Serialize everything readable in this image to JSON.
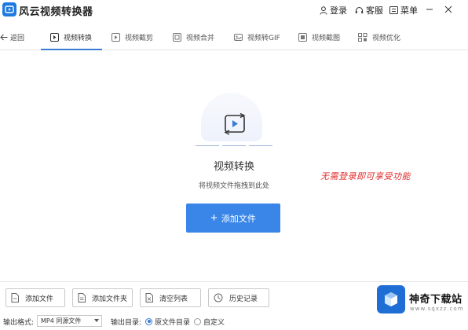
{
  "app": {
    "title": "风云视频转换器"
  },
  "titlebar": {
    "login": "登录",
    "service": "客服",
    "menu": "菜单"
  },
  "nav": {
    "back": "返回",
    "tabs": [
      {
        "label": "视频转换",
        "icon": "video-convert-icon",
        "active": true
      },
      {
        "label": "视频截剪",
        "icon": "video-cut-icon",
        "active": false
      },
      {
        "label": "视频合并",
        "icon": "video-merge-icon",
        "active": false
      },
      {
        "label": "视频转GIF",
        "icon": "gif-icon",
        "active": false
      },
      {
        "label": "视频截图",
        "icon": "screenshot-icon",
        "active": false
      },
      {
        "label": "视频优化",
        "icon": "optimize-icon",
        "active": false
      }
    ]
  },
  "main": {
    "heading": "视频转换",
    "subtitle": "将视频文件拖拽到此处",
    "add_file_label": "添加文件",
    "promo": "无需登录即可享受功能"
  },
  "bottom": {
    "add_file": "添加文件",
    "add_folder": "添加文件夹",
    "clear_list": "清空列表",
    "history": "历史记录",
    "output_format_label": "输出格式:",
    "output_format_value": "MP4 同源文件",
    "output_dir_label": "输出目录:",
    "option_source": "原文件目录",
    "option_custom": "自定义"
  },
  "watermark": {
    "name": "神奇下载站",
    "url": "www.sqxzz.com"
  },
  "colors": {
    "accent": "#3a86e8",
    "promo": "#e02a2a",
    "logo": "#1e6ed6"
  }
}
